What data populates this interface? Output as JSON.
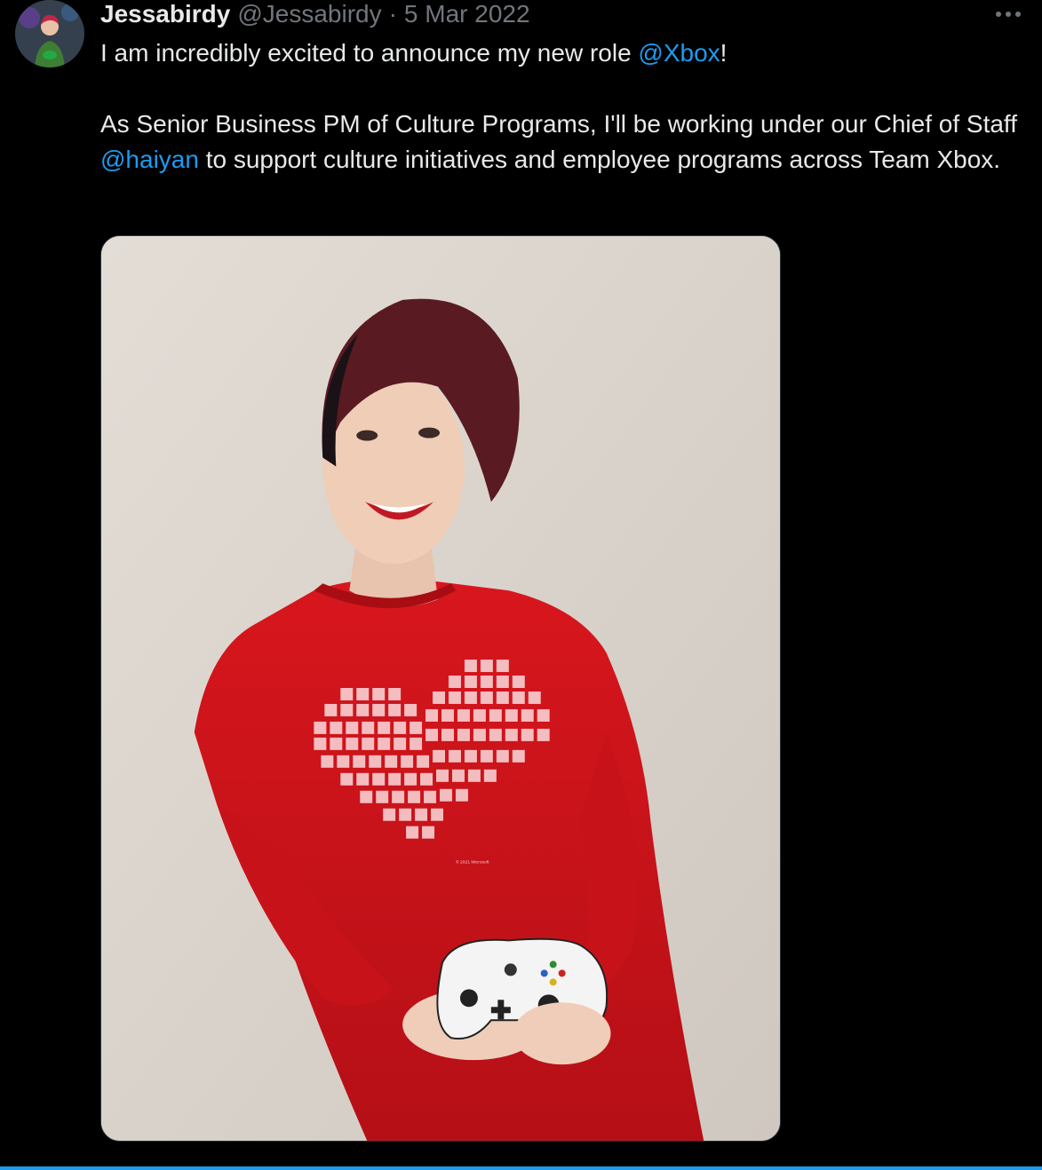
{
  "tweet": {
    "display_name": "Jessabirdy",
    "handle": "@Jessabirdy",
    "separator": "·",
    "date": "5 Mar 2022",
    "more_label": "···",
    "line1": {
      "before": "I am incredibly excited to announce my new role ",
      "mention": "@Xbox",
      "after": "!"
    },
    "line2": {
      "before": "As Senior Business PM of Culture Programs, I'll be working under our Chief of Staff ",
      "mention": "@haiyan",
      "after": " to support culture initiatives and employee programs across Team Xbox."
    },
    "media": {
      "icon": "photo",
      "shirt_print": "© 2021 Microsoft"
    }
  },
  "colors": {
    "background": "#000000",
    "text": "#e7e9ea",
    "muted": "#71767b",
    "link": "#1d9bf0",
    "shirt": "#d2151c"
  }
}
